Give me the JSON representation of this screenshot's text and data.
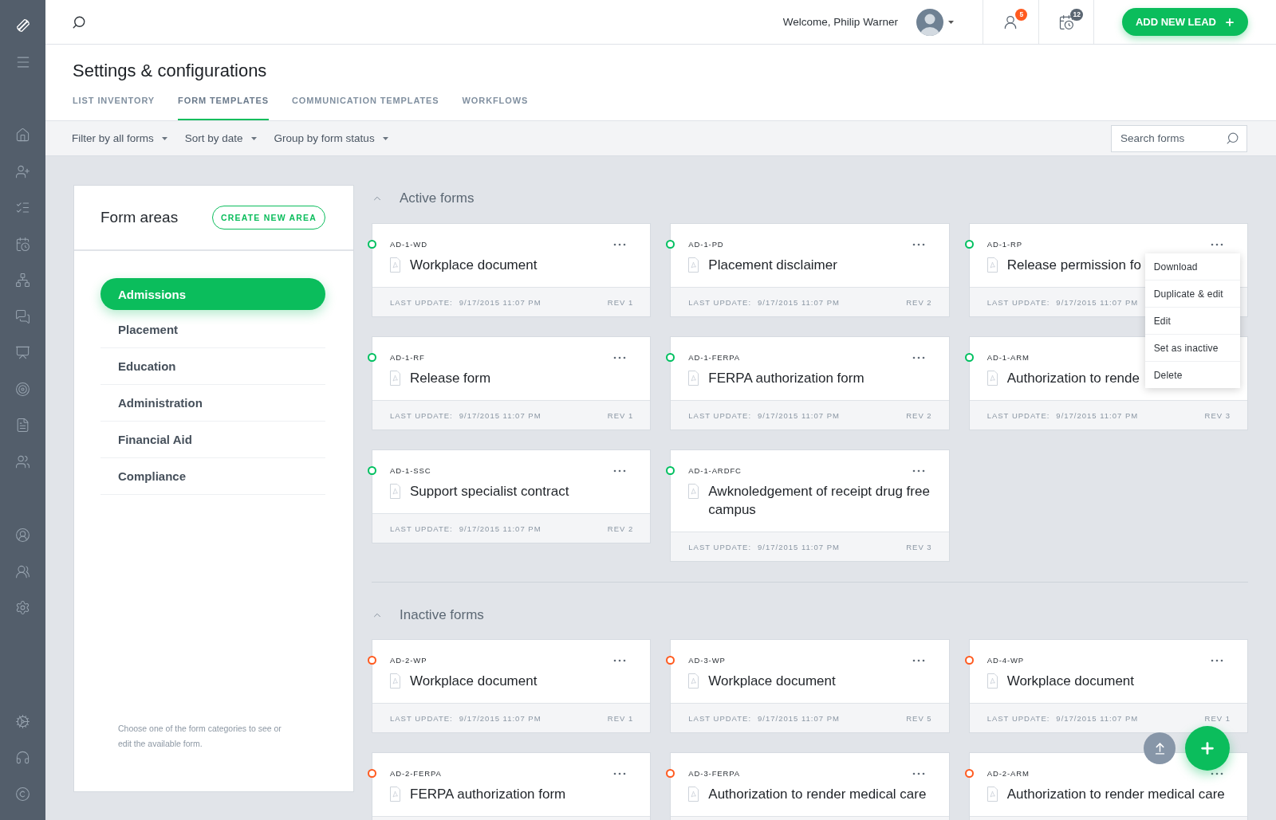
{
  "top_bar": {
    "welcome": "Welcome, Philip Warner",
    "alerts": [
      {
        "count": "5",
        "color": "#ff5a1f"
      },
      {
        "count": "12",
        "color": "#5b6672"
      }
    ],
    "add_button": "ADD NEW LEAD"
  },
  "page": {
    "title": "Settings & configurations",
    "tabs": [
      {
        "label": "LIST INVENTORY",
        "selected": false
      },
      {
        "label": "FORM TEMPLATES",
        "selected": true
      },
      {
        "label": "COMMUNICATION TEMPLATES",
        "selected": false
      },
      {
        "label": "WORKFLOWS",
        "selected": false
      }
    ]
  },
  "filters": {
    "dropdowns": [
      "Filter by all forms",
      "Sort by date",
      "Group by form status"
    ],
    "search": {
      "placeholder": "Search forms"
    }
  },
  "form_areas": {
    "title": "Form areas",
    "create_button": "CREATE NEW AREA",
    "items": [
      {
        "label": "Admissions",
        "selected": true
      },
      {
        "label": "Placement",
        "selected": false
      },
      {
        "label": "Education",
        "selected": false
      },
      {
        "label": "Administration",
        "selected": false
      },
      {
        "label": "Financial Aid",
        "selected": false
      },
      {
        "label": "Compliance",
        "selected": false
      }
    ],
    "hint": "Choose one of the form categories to see or edit the available form."
  },
  "sections": [
    {
      "title": "Active forms",
      "expanded": true,
      "forms": [
        {
          "code": "AD-1-WD",
          "title": "Workplace document",
          "color": "#00c060",
          "updated_label": "LAST UPDATE:",
          "updated": "9/17/2015 11:07 PM",
          "rev": "REV 1"
        },
        {
          "code": "AD-1-PD",
          "title": "Placement disclaimer",
          "color": "#00c060",
          "updated_label": "LAST UPDATE:",
          "updated": "9/17/2015 11:07 PM",
          "rev": "REV 2"
        },
        {
          "code": "AD-1-RP",
          "title": "Release permission fo",
          "color": "#00c060",
          "updated_label": "LAST UPDATE:",
          "updated": "9/17/2015 11:07 PM",
          "menu": [
            "Download",
            "Duplicate & edit",
            "Edit",
            "Set as inactive",
            "Delete"
          ]
        },
        {
          "code": "AD-1-RF",
          "title": "Release form",
          "color": "#00c060",
          "updated_label": "LAST UPDATE:",
          "updated": "9/17/2015 11:07 PM",
          "rev": "REV 1"
        },
        {
          "code": "AD-1-FERPA",
          "title": "FERPA authorization form",
          "color": "#00c060",
          "updated_label": "LAST UPDATE:",
          "updated": "9/17/2015 11:07 PM",
          "rev": "REV 2"
        },
        {
          "code": "AD-1-ARM",
          "title": "Authorization to rende",
          "color": "#00c060",
          "updated_label": "LAST UPDATE:",
          "updated": "9/17/2015 11:07 PM",
          "rev": "REV 3"
        },
        {
          "code": "AD-1-SSC",
          "title": "Support specialist contract",
          "color": "#00c060",
          "updated_label": "LAST UPDATE:",
          "updated": "9/17/2015 11:07 PM",
          "rev": "REV 2"
        },
        {
          "code": "AD-1-ARDFC",
          "title": "Awknoledgement of receipt drug free campus",
          "color": "#00c060",
          "updated_label": "LAST UPDATE:",
          "updated": "9/17/2015 11:07 PM",
          "rev": "REV 3"
        }
      ]
    },
    {
      "title": "Inactive forms",
      "expanded": true,
      "forms": [
        {
          "code": "AD-2-WP",
          "title": "Workplace document",
          "color": "#ff5a1f",
          "updated_label": "LAST UPDATE:",
          "updated": "9/17/2015 11:07 PM",
          "rev": "REV 1"
        },
        {
          "code": "AD-3-WP",
          "title": "Workplace document",
          "color": "#ff5a1f",
          "updated_label": "LAST UPDATE:",
          "updated": "9/17/2015 11:07 PM",
          "rev": "REV 5"
        },
        {
          "code": "AD-4-WP",
          "title": "Workplace document",
          "color": "#ff5a1f",
          "updated_label": "LAST UPDATE:",
          "updated": "9/17/2015 11:07 PM",
          "rev": "REV 1"
        },
        {
          "code": "AD-2-FERPA",
          "title": "FERPA authorization form",
          "color": "#ff5a1f"
        },
        {
          "code": "AD-3-FERPA",
          "title": "Authorization to render medical care",
          "color": "#ff5a1f"
        },
        {
          "code": "AD-2-ARM",
          "title": "Authorization to render medical care",
          "color": "#ff5a1f"
        }
      ]
    }
  ]
}
